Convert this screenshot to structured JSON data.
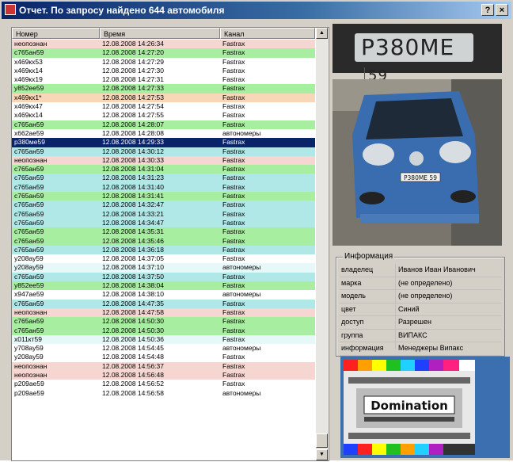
{
  "window": {
    "title": "Отчет. По запросу найдено 644 автомобиля",
    "help_label": "?",
    "close_label": "×"
  },
  "table": {
    "columns": [
      "Номер",
      "Время",
      "Канал"
    ],
    "rows": [
      {
        "number": "неопознан",
        "time": "12.08.2008 14:26:34",
        "channel": "Fastrax",
        "bg": "#f6d6d0"
      },
      {
        "number": "c765ан59",
        "time": "12.08.2008 14:27:20",
        "channel": "Fastrax",
        "bg": "#a8eea0"
      },
      {
        "number": "x469кх53",
        "time": "12.08.2008 14:27:29",
        "channel": "Fastrax",
        "bg": "#ffffff"
      },
      {
        "number": "x469кх14",
        "time": "12.08.2008 14:27:30",
        "channel": "Fastrax",
        "bg": "#ffffff"
      },
      {
        "number": "x469кх19",
        "time": "12.08.2008 14:27:31",
        "channel": "Fastrax",
        "bg": "#ffffff"
      },
      {
        "number": "y852ее59",
        "time": "12.08.2008 14:27:33",
        "channel": "Fastrax",
        "bg": "#a8eea0"
      },
      {
        "number": "x469кх1*",
        "time": "12.08.2008 14:27:53",
        "channel": "Fastrax",
        "bg": "#f8d6b8"
      },
      {
        "number": "x469кх47",
        "time": "12.08.2008 14:27:54",
        "channel": "Fastrax",
        "bg": "#ffffff"
      },
      {
        "number": "x469кх14",
        "time": "12.08.2008 14:27:55",
        "channel": "Fastrax",
        "bg": "#ffffff"
      },
      {
        "number": "c765ан59",
        "time": "12.08.2008 14:28:07",
        "channel": "Fastrax",
        "bg": "#a8eea0"
      },
      {
        "number": "x662ае59",
        "time": "12.08.2008 14:28:08",
        "channel": "автономеры",
        "bg": "#ffffff"
      },
      {
        "number": "p380ме59",
        "time": "12.08.2008 14:29:33",
        "channel": "Fastrax",
        "bg": "#0a246a",
        "fg": "#ffffff"
      },
      {
        "number": "c765ан59",
        "time": "12.08.2008 14:30:12",
        "channel": "Fastrax",
        "bg": "#b0e8e8"
      },
      {
        "number": "неопознан",
        "time": "12.08.2008 14:30:33",
        "channel": "Fastrax",
        "bg": "#f6d6d0"
      },
      {
        "number": "c765ан59",
        "time": "12.08.2008 14:31:04",
        "channel": "Fastrax",
        "bg": "#a8eea0"
      },
      {
        "number": "c765ан59",
        "time": "12.08.2008 14:31:23",
        "channel": "Fastrax",
        "bg": "#b0e8e8"
      },
      {
        "number": "c765ан59",
        "time": "12.08.2008 14:31:40",
        "channel": "Fastrax",
        "bg": "#b0e8e8"
      },
      {
        "number": "c765ан59",
        "time": "12.08.2008 14:31:41",
        "channel": "Fastrax",
        "bg": "#a8eea0"
      },
      {
        "number": "c765ан59",
        "time": "12.08.2008 14:32:47",
        "channel": "Fastrax",
        "bg": "#b0e8e8"
      },
      {
        "number": "c765ан59",
        "time": "12.08.2008 14:33:21",
        "channel": "Fastrax",
        "bg": "#b0e8e8"
      },
      {
        "number": "c765ан59",
        "time": "12.08.2008 14:34:47",
        "channel": "Fastrax",
        "bg": "#b0e8e8"
      },
      {
        "number": "c765ан59",
        "time": "12.08.2008 14:35:31",
        "channel": "Fastrax",
        "bg": "#a8eea0"
      },
      {
        "number": "c765ан59",
        "time": "12.08.2008 14:35:46",
        "channel": "Fastrax",
        "bg": "#a8eea0"
      },
      {
        "number": "c765ан59",
        "time": "12.08.2008 14:36:18",
        "channel": "Fastrax",
        "bg": "#b0e8e8"
      },
      {
        "number": "y208ау59",
        "time": "12.08.2008 14:37:05",
        "channel": "Fastrax",
        "bg": "#ffffff"
      },
      {
        "number": "y208ау59",
        "time": "12.08.2008 14:37:10",
        "channel": "автономеры",
        "bg": "#e6f8f8"
      },
      {
        "number": "c765ан59",
        "time": "12.08.2008 14:37:50",
        "channel": "Fastrax",
        "bg": "#b0e8e8"
      },
      {
        "number": "y852ее59",
        "time": "12.08.2008 14:38:04",
        "channel": "Fastrax",
        "bg": "#a8eea0"
      },
      {
        "number": "x947ае59",
        "time": "12.08.2008 14:38:10",
        "channel": "автономеры",
        "bg": "#ffffff"
      },
      {
        "number": "c765ан59",
        "time": "12.08.2008 14:47:35",
        "channel": "Fastrax",
        "bg": "#b0e8e8"
      },
      {
        "number": "неопознан",
        "time": "12.08.2008 14:47:58",
        "channel": "Fastrax",
        "bg": "#f6d6d0"
      },
      {
        "number": "c765ан59",
        "time": "12.08.2008 14:50:30",
        "channel": "Fastrax",
        "bg": "#a8eea0"
      },
      {
        "number": "c765ан59",
        "time": "12.08.2008 14:50:30",
        "channel": "Fastrax",
        "bg": "#a8eea0"
      },
      {
        "number": "x011кт59",
        "time": "12.08.2008 14:50:36",
        "channel": "Fastrax",
        "bg": "#e6f8f8"
      },
      {
        "number": "y708ау59",
        "time": "12.08.2008 14:54:45",
        "channel": "автономеры",
        "bg": "#ffffff"
      },
      {
        "number": "y208ау59",
        "time": "12.08.2008 14:54:48",
        "channel": "Fastrax",
        "bg": "#ffffff"
      },
      {
        "number": "неопознан",
        "time": "12.08.2008 14:56:37",
        "channel": "Fastrax",
        "bg": "#f6d6d0"
      },
      {
        "number": "неопознан",
        "time": "12.08.2008 14:56:48",
        "channel": "Fastrax",
        "bg": "#f6d6d0"
      },
      {
        "number": "p209ае59",
        "time": "12.08.2008 14:56:52",
        "channel": "Fastrax",
        "bg": "#ffffff"
      },
      {
        "number": "p209ае59",
        "time": "12.08.2008 14:56:58",
        "channel": "автономеры",
        "bg": "#ffffff"
      }
    ]
  },
  "plate": {
    "text": "P380ME",
    "region": "59"
  },
  "car_plate_text": "P380ME 59",
  "info": {
    "title": "Информация",
    "rows": [
      {
        "key": "владелец",
        "value": "Иванов Иван Иванович"
      },
      {
        "key": "марка",
        "value": "(не определено)"
      },
      {
        "key": "модель",
        "value": "(не определено)"
      },
      {
        "key": "цвет",
        "value": "Синий"
      },
      {
        "key": "доступ",
        "value": "Разрешен"
      },
      {
        "key": "группа",
        "value": "ВИПАКС"
      },
      {
        "key": "информация",
        "value": "Менеджеры Випакс"
      }
    ]
  },
  "test_pattern": {
    "logo_text": "Domination"
  },
  "icons": [
    "app-icon",
    "help-icon",
    "close-icon",
    "scroll-up-icon",
    "scroll-down-icon"
  ]
}
